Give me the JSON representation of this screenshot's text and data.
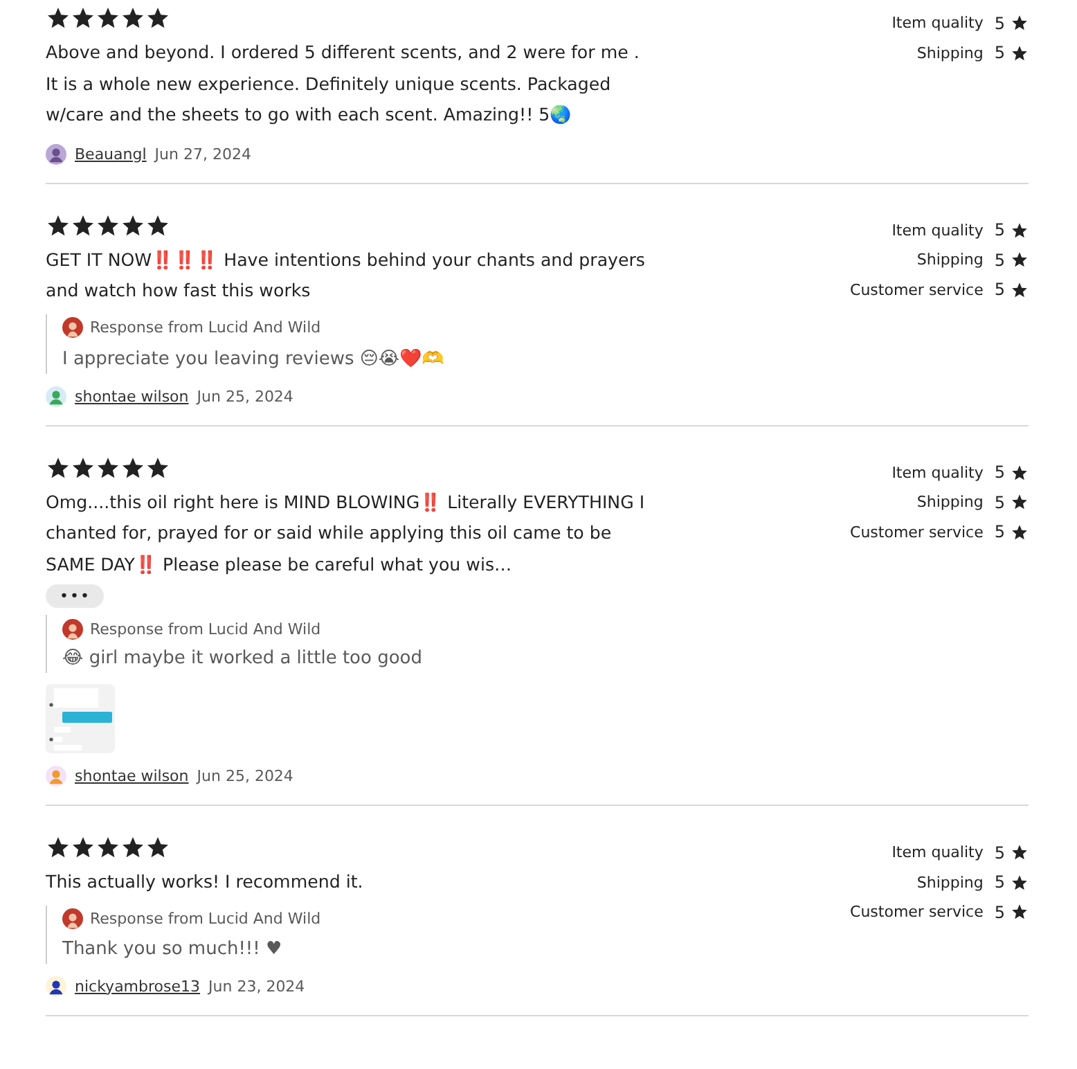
{
  "reviews": [
    {
      "stars": 5,
      "text": "Above and beyond. I ordered 5 different scents, and 2 were for me . It is a whole new experience. Definitely unique scents. Packaged w/care and the sheets to go with each scent. Amazing!! 5🌏",
      "reviewer": "Beauangl",
      "date": "Jun 27, 2024",
      "ratings": [
        {
          "label": "Item quality",
          "value": "5"
        },
        {
          "label": "Shipping",
          "value": "5"
        }
      ]
    },
    {
      "stars": 5,
      "text": "GET IT NOW‼️‼️‼️ Have intentions behind your chants and prayers and watch how fast this works",
      "response": {
        "from": "Response from Lucid And Wild",
        "text": "I appreciate you leaving reviews 😔😭❤️🫶"
      },
      "reviewer": "shontae wilson",
      "date": "Jun 25, 2024",
      "ratings": [
        {
          "label": "Item quality",
          "value": "5"
        },
        {
          "label": "Shipping",
          "value": "5"
        },
        {
          "label": "Customer service",
          "value": "5"
        }
      ]
    },
    {
      "stars": 5,
      "text": "Omg....this oil right here is MIND BLOWING‼️ Literally EVERYTHING I chanted for, prayed for or said while applying this oil came to be SAME DAY‼️ Please please be careful what you wis…",
      "more": "•••",
      "response": {
        "from": "Response from Lucid And Wild",
        "text": "😂 girl maybe it worked a little too good"
      },
      "photos": [
        {
          "kind": "picture"
        }
      ],
      "reviewer": "shontae wilson",
      "date": "Jun 25, 2024",
      "ratings": [
        {
          "label": "Item quality",
          "value": "5"
        },
        {
          "label": "Shipping",
          "value": "5"
        },
        {
          "label": "Customer service",
          "value": "5"
        }
      ]
    },
    {
      "stars": 5,
      "text": "This actually works! I recommend it.",
      "response": {
        "from": "Response from Lucid And Wild",
        "text": "Thank you so much!!! ♥"
      },
      "reviewer": "nickyambrose13",
      "date": "Jun 23, 2024",
      "ratings": [
        {
          "label": "Item quality",
          "value": "5"
        },
        {
          "label": "Shipping",
          "value": "5"
        },
        {
          "label": "Customer service",
          "value": "5"
        }
      ]
    }
  ]
}
